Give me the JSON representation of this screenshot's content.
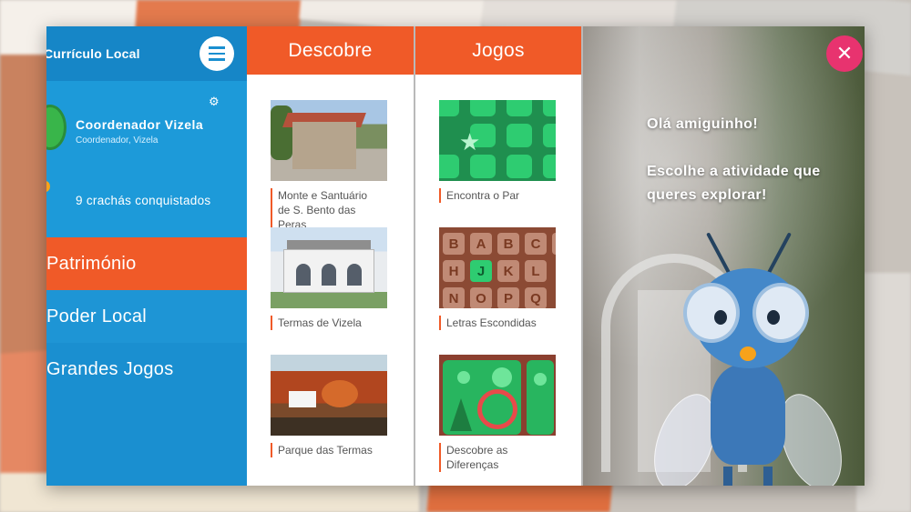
{
  "sidebar": {
    "app_title": "Currículo Local",
    "user": {
      "name": "Coordenador  Vizela",
      "subtitle": "Coordenador, Vizela"
    },
    "badges": "9 crachás conquistados",
    "nav": [
      {
        "label": "Património",
        "active": true
      },
      {
        "label": "Poder Local",
        "active": false
      },
      {
        "label": "Grandes Jogos",
        "active": false
      }
    ]
  },
  "columns": {
    "discover": {
      "title": "Descobre",
      "items": [
        {
          "label": "Monte e Santuário de S. Bento das Peras"
        },
        {
          "label": "Termas de Vizela"
        },
        {
          "label": "Parque das Termas"
        }
      ]
    },
    "games": {
      "title": "Jogos",
      "items": [
        {
          "label": "Encontra o Par"
        },
        {
          "label": "Letras Escondidas"
        },
        {
          "label": "Descobre as Diferenças"
        }
      ]
    }
  },
  "hero": {
    "greeting": "Olá amiguinho!",
    "prompt": "Escolhe a atividade que queres explorar!"
  },
  "icons": {
    "menu": "hamburger-icon",
    "settings": "gear-icon",
    "close": "close-icon"
  },
  "colors": {
    "sidebar_blue": "#1a8fd0",
    "accent_orange": "#f05a28",
    "close_pink": "#e8336f"
  }
}
